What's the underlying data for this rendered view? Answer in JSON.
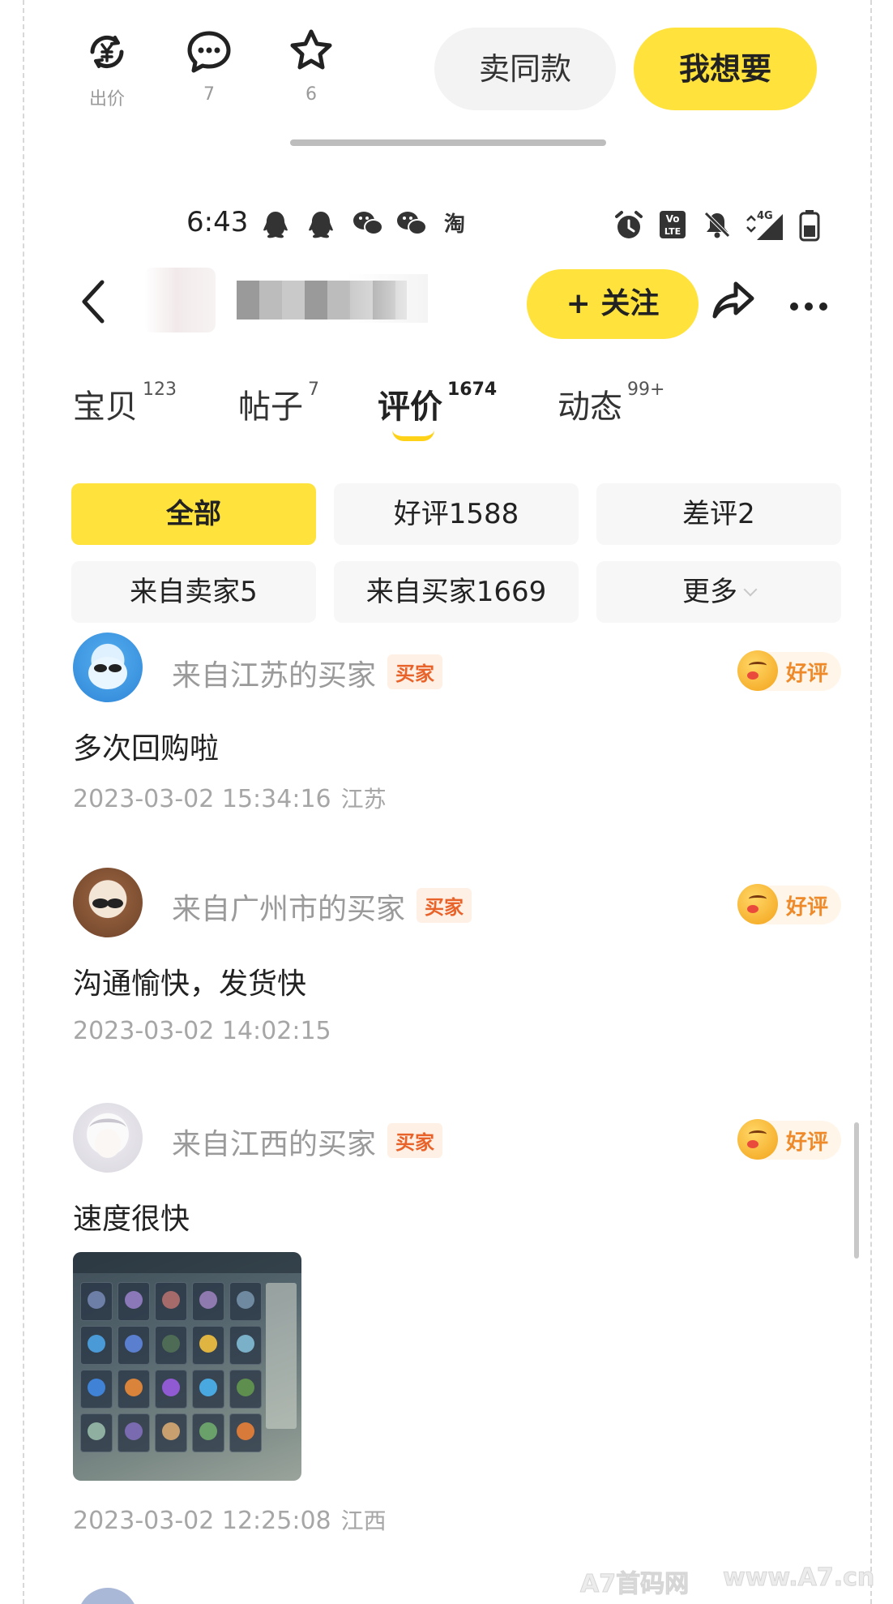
{
  "action_bar": {
    "offer_label": "出价",
    "comment_count": "7",
    "favorite_count": "6",
    "sell_same_label": "卖同款",
    "want_label": "我想要"
  },
  "status_bar": {
    "time": "6:43",
    "network": "4G"
  },
  "header": {
    "follow_label": "+ 关注"
  },
  "tabs": [
    {
      "label": "宝贝",
      "count": "123"
    },
    {
      "label": "帖子",
      "count": "7"
    },
    {
      "label": "评价",
      "count": "1674"
    },
    {
      "label": "动态",
      "count": "99+"
    }
  ],
  "active_tab": "评价",
  "filters": [
    {
      "label": "全部"
    },
    {
      "label": "好评1588"
    },
    {
      "label": "差评2"
    },
    {
      "label": "来自卖家5"
    },
    {
      "label": "来自买家1669"
    },
    {
      "label": "更多"
    }
  ],
  "reviews": [
    {
      "who": "来自江苏的买家",
      "badge": "买家",
      "rating": "好评",
      "content": "多次回购啦",
      "date": "2023-03-02 15:34:16",
      "location": "江苏"
    },
    {
      "who": "来自广州市的买家",
      "badge": "买家",
      "rating": "好评",
      "content": "沟通愉快，发货快",
      "date": "2023-03-02 14:02:15",
      "location": ""
    },
    {
      "who": "来自江西的买家",
      "badge": "买家",
      "rating": "好评",
      "content": "速度很快",
      "date": "2023-03-02 12:25:08",
      "location": "江西"
    }
  ],
  "watermark": {
    "left": "A7首码网",
    "right": "www.A7.cn"
  },
  "colors": {
    "accent_yellow": "#ffe33c",
    "buyer_badge": "#e8632a",
    "good_rating": "#ee8a2a"
  }
}
